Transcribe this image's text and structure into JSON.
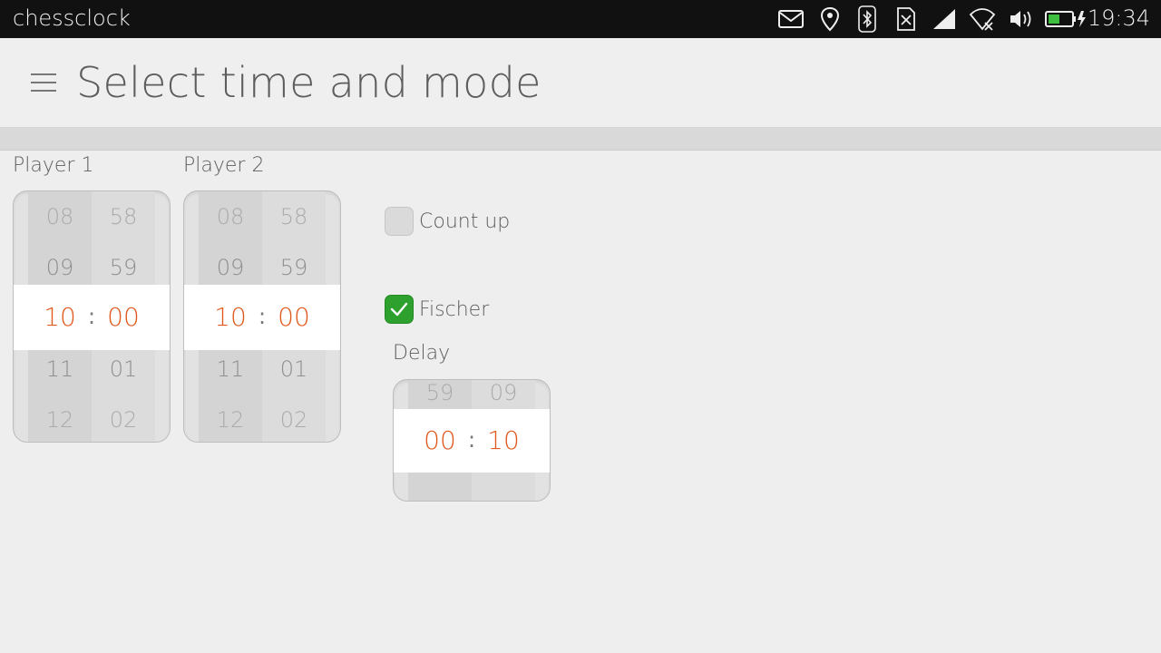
{
  "statusbar": {
    "app_name": "chessclock",
    "time": "19:34",
    "icons": [
      "mail-icon",
      "location-icon",
      "bluetooth-icon",
      "sim-icon",
      "signal-icon",
      "wifi-icon",
      "volume-icon",
      "battery-icon"
    ]
  },
  "header": {
    "title": "Select time and mode",
    "menu_icon": "hamburger-icon"
  },
  "player1": {
    "label": "Player 1",
    "minutes": [
      "08",
      "09",
      "10",
      "11",
      "12"
    ],
    "seconds": [
      "58",
      "59",
      "00",
      "01",
      "02"
    ],
    "selected_minutes": "10",
    "selected_seconds": "00"
  },
  "player2": {
    "label": "Player 2",
    "minutes": [
      "08",
      "09",
      "10",
      "11",
      "12"
    ],
    "seconds": [
      "58",
      "59",
      "00",
      "01",
      "02"
    ],
    "selected_minutes": "10",
    "selected_seconds": "00"
  },
  "options": {
    "count_up": {
      "label": "Count up",
      "checked": false
    },
    "fischer": {
      "label": "Fischer",
      "checked": true
    }
  },
  "delay": {
    "label": "Delay",
    "minutes": [
      "59",
      "00"
    ],
    "seconds": [
      "09",
      "10"
    ],
    "selected_minutes": "00",
    "selected_seconds": "10"
  },
  "colors": {
    "accent": "#e0591d",
    "check_green": "#2ea02e"
  }
}
